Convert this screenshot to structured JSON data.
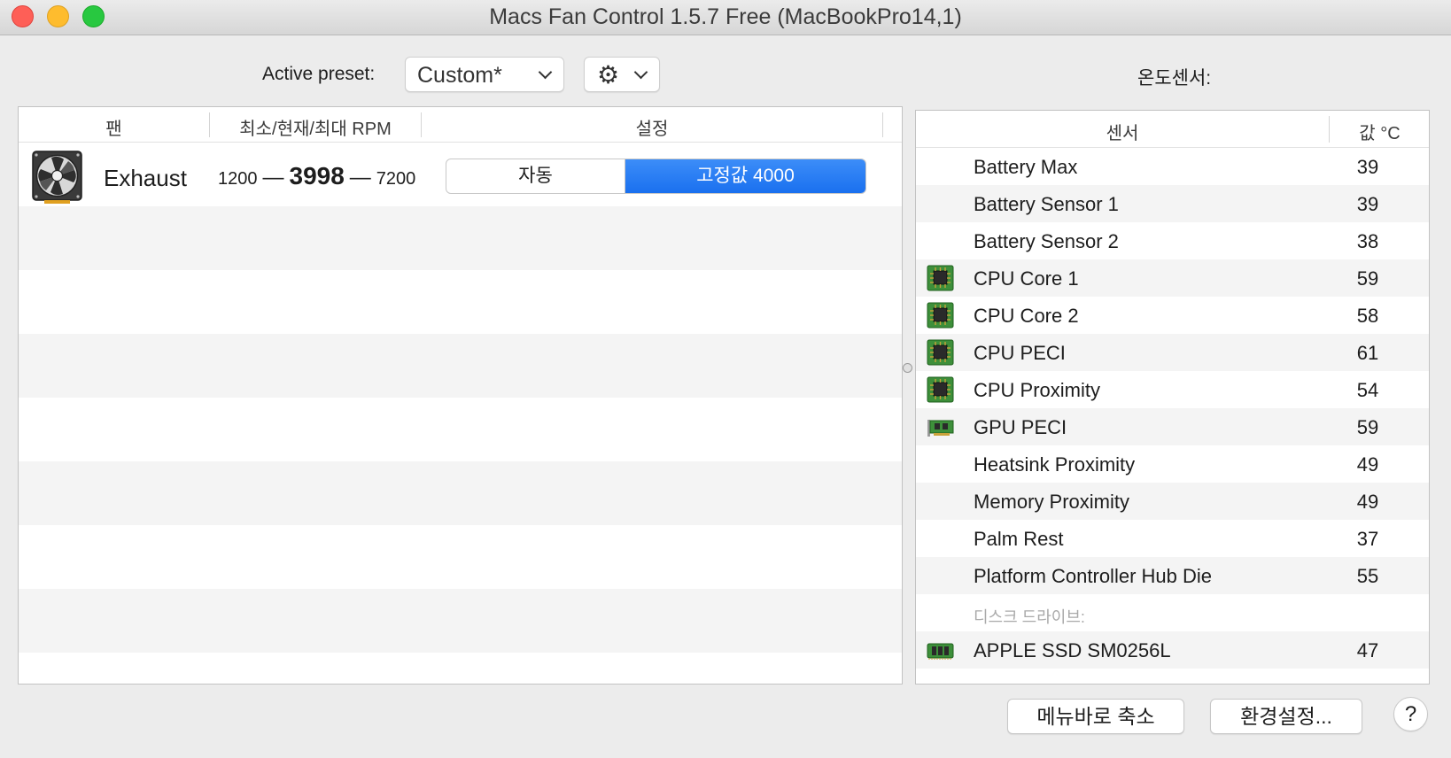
{
  "window": {
    "title": "Macs Fan Control 1.5.7 Free (MacBookPro14,1)"
  },
  "preset": {
    "label": "Active preset:",
    "value": "Custom*"
  },
  "sensors_label": "온도센서:",
  "fan_table": {
    "headers": {
      "fan": "팬",
      "rpm": "최소/현재/최대 RPM",
      "control": "설정"
    },
    "fans": [
      {
        "name": "Exhaust",
        "min_rpm": "1200",
        "current_rpm": "3998",
        "max_rpm": "7200",
        "dash": "—",
        "auto_label": "자동",
        "fixed_label": "고정값 4000",
        "selected": "fixed"
      }
    ]
  },
  "sensor_table": {
    "headers": {
      "sensor": "센서",
      "value": "값 °C"
    },
    "rows": [
      {
        "name": "Battery Max",
        "value": "39",
        "icon": ""
      },
      {
        "name": "Battery Sensor 1",
        "value": "39",
        "icon": ""
      },
      {
        "name": "Battery Sensor 2",
        "value": "38",
        "icon": ""
      },
      {
        "name": "CPU Core 1",
        "value": "59",
        "icon": "cpu-chip-icon"
      },
      {
        "name": "CPU Core 2",
        "value": "58",
        "icon": "cpu-chip-icon"
      },
      {
        "name": "CPU PECI",
        "value": "61",
        "icon": "cpu-chip-icon"
      },
      {
        "name": "CPU Proximity",
        "value": "54",
        "icon": "cpu-chip-icon"
      },
      {
        "name": "GPU PECI",
        "value": "59",
        "icon": "gpu-card-icon"
      },
      {
        "name": "Heatsink Proximity",
        "value": "49",
        "icon": ""
      },
      {
        "name": "Memory Proximity",
        "value": "49",
        "icon": ""
      },
      {
        "name": "Palm Rest",
        "value": "37",
        "icon": ""
      },
      {
        "name": "Platform Controller Hub Die",
        "value": "55",
        "icon": ""
      },
      {
        "group": "디스크 드라이브:"
      },
      {
        "name": "APPLE SSD SM0256L",
        "value": "47",
        "icon": "ssd-drive-icon"
      }
    ]
  },
  "buttons": {
    "menubar": "메뉴바로 축소",
    "preferences": "환경설정...",
    "help": "?"
  },
  "colors": {
    "accent": "#1a70ef",
    "chip_green": "#3d8f3a"
  }
}
